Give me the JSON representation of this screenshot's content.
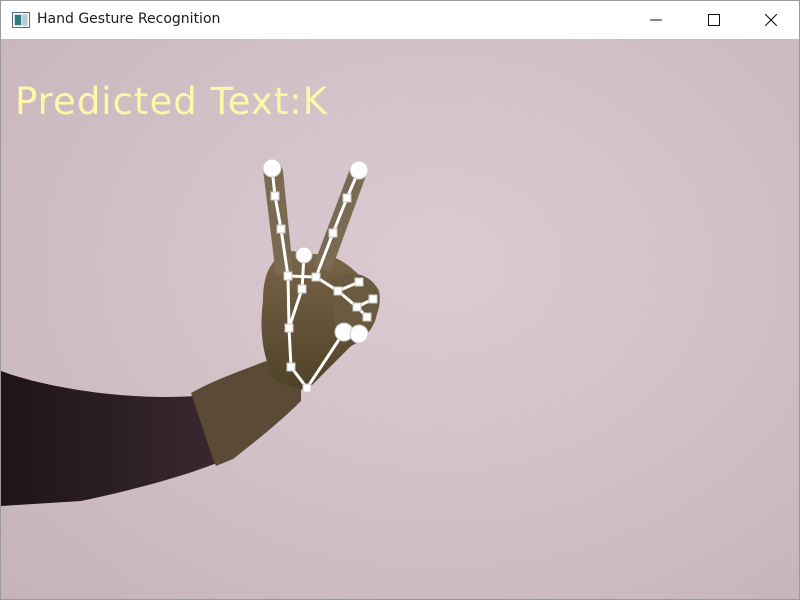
{
  "window": {
    "title": "Hand Gesture Recognition",
    "icon": "app-window-icon",
    "controls": [
      "minimize-icon",
      "maximize-icon",
      "close-icon"
    ]
  },
  "overlay": {
    "prediction_label": "Predicted Text:K"
  },
  "colors": {
    "titlebar_bg": "#ffffff",
    "wall": "#d5c4cb",
    "overlay_text": "#fff7a8",
    "landmark": "#ffffff",
    "sleeve": "#2a1c22"
  }
}
